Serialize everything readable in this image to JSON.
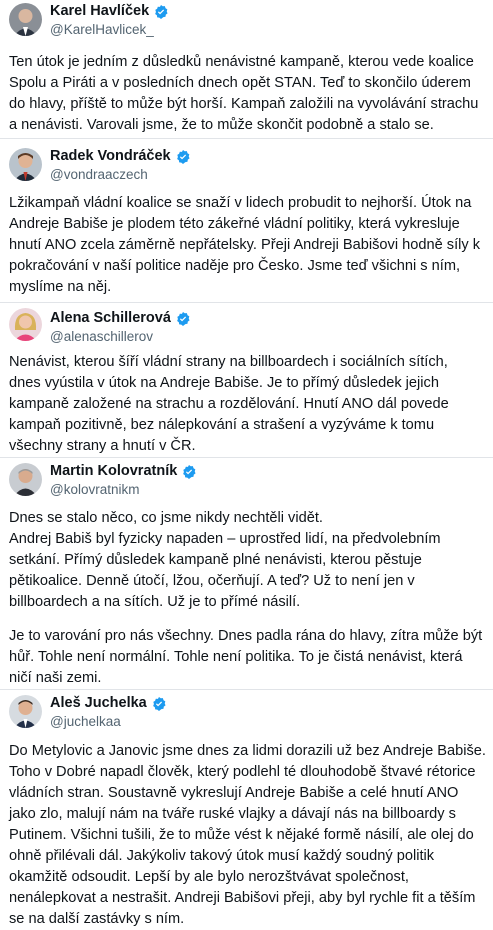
{
  "posts": [
    {
      "name": "Karel Havlíček",
      "handle": "@KarelHavlicek_",
      "lines": [
        "Ten útok je jedním z důsledků nenávistné kampaně, kterou vede koalice",
        "Spolu a Piráti a v posledních dnech opět STAN. Teď to skončilo úderem",
        "do hlavy, příště to může být horší. Kampaň založili na vyvolávání strachu",
        "a nenávisti. Varovali jsme, že to může skončit podobně a stalo se."
      ]
    },
    {
      "name": "Radek Vondráček",
      "handle": "@vondraaczech",
      "lines": [
        "Lžikampaň vládní koalice se snaží v lidech probudit to nejhorší. Útok na",
        "Andreje Babiše je plodem této zákeřné vládní politiky, která vykresluje",
        "hnutí ANO zcela záměrně nepřátelsky. Přeji Andreji Babišovi hodně síly k",
        "pokračování v naší politice naděje pro Česko. Jsme teď všichni s ním,",
        "myslíme na něj."
      ]
    },
    {
      "name": "Alena Schillerová",
      "handle": "@alenaschillerov",
      "lines": [
        "Nenávist, kterou šíří vládní strany na billboardech i sociálních sítích,",
        "dnes vyústila v útok na Andreje Babiše. Je to přímý důsledek jejich",
        "kampaně založené na strachu a rozdělování. Hnutí ANO dál povede",
        "kampaň pozitivně, bez nálepkování a strašení a vyzýváme k tomu",
        "všechny strany a hnutí v ČR."
      ]
    },
    {
      "name": "Martin Kolovratník",
      "handle": "@kolovratnikm",
      "paragraphs": [
        [
          "Dnes se stalo něco, co jsme nikdy nechtěli vidět.",
          "Andrej Babiš byl fyzicky napaden – uprostřed lidí, na předvolebním",
          "setkání. Přímý důsledek kampaně plné nenávisti, kterou pěstuje",
          "pětikoalice. Denně útočí, lžou, očerňují. A teď? Už to není jen v",
          "billboardech a na sítích. Už je to přímé násilí."
        ],
        [
          "Je to varování pro nás všechny. Dnes padla rána do hlavy, zítra může být",
          "hůř. Tohle není normální. Tohle není politika. To je čistá nenávist, která",
          "ničí naši zemi."
        ]
      ]
    },
    {
      "name": "Aleš Juchelka",
      "handle": "@juchelkaa",
      "lines": [
        "Do Metylovic a Janovic jsme dnes za lidmi dorazili už bez Andreje Babiše.",
        "Toho v Dobré napadl člověk, který podlehl té dlouhodobě štvavé rétorice",
        "vládních stran. Soustavně vykreslují Andreje Babiše a celé hnutí ANO",
        "jako zlo, malují nám na tváře ruské vlajky a dávají nás na billboardy s",
        "Putinem. Všichni tušili, že to může vést k nějaké formě násilí, ale olej do",
        "ohně přilévali dál. Jakýkoliv takový útok musí každý soudný politik",
        "okamžitě odsoudit. Lepší by ale bylo nerozštvávat společnost,",
        "nenálepkovat a nestrašit. Andreji Babišovi přeji, aby byl rychle fit a těším",
        "se na další zastávky s ním."
      ]
    }
  ],
  "colors": {
    "verified": "#1d9bf0",
    "handle": "#536471",
    "text": "#0f1419"
  },
  "icons": {
    "verified": "verified-badge-icon"
  }
}
